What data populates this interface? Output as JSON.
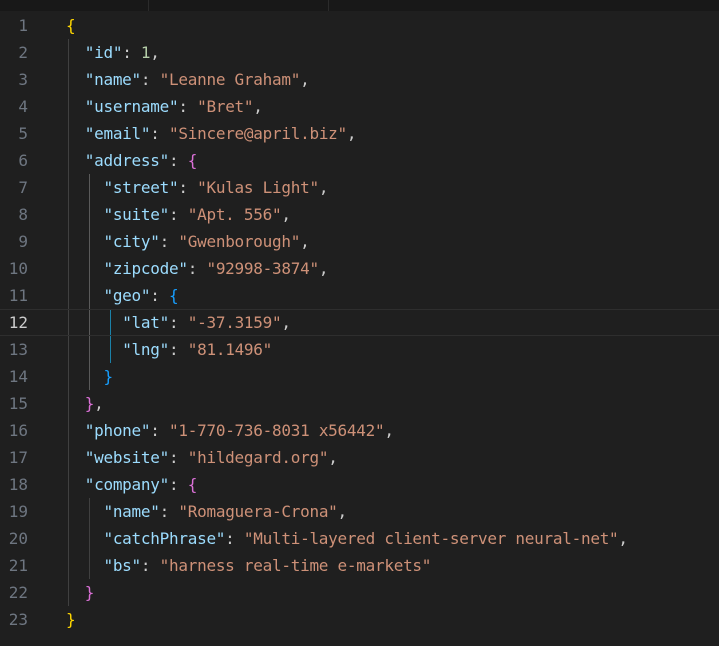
{
  "editor": {
    "active_line": 12,
    "lines": [
      {
        "n": "1",
        "tokens": [
          {
            "t": "{",
            "c": "b1"
          }
        ]
      },
      {
        "n": "2",
        "tokens": [
          {
            "t": "  "
          },
          {
            "t": "\"id\"",
            "c": "key"
          },
          {
            "t": ": "
          },
          {
            "t": "1",
            "c": "num"
          },
          {
            "t": ","
          }
        ]
      },
      {
        "n": "3",
        "tokens": [
          {
            "t": "  "
          },
          {
            "t": "\"name\"",
            "c": "key"
          },
          {
            "t": ": "
          },
          {
            "t": "\"Leanne Graham\"",
            "c": "str"
          },
          {
            "t": ","
          }
        ]
      },
      {
        "n": "4",
        "tokens": [
          {
            "t": "  "
          },
          {
            "t": "\"username\"",
            "c": "key"
          },
          {
            "t": ": "
          },
          {
            "t": "\"Bret\"",
            "c": "str"
          },
          {
            "t": ","
          }
        ]
      },
      {
        "n": "5",
        "tokens": [
          {
            "t": "  "
          },
          {
            "t": "\"email\"",
            "c": "key"
          },
          {
            "t": ": "
          },
          {
            "t": "\"Sincere@april.biz\"",
            "c": "str"
          },
          {
            "t": ","
          }
        ]
      },
      {
        "n": "6",
        "tokens": [
          {
            "t": "  "
          },
          {
            "t": "\"address\"",
            "c": "key"
          },
          {
            "t": ": "
          },
          {
            "t": "{",
            "c": "b2"
          }
        ]
      },
      {
        "n": "7",
        "tokens": [
          {
            "t": "    "
          },
          {
            "t": "\"street\"",
            "c": "key"
          },
          {
            "t": ": "
          },
          {
            "t": "\"Kulas Light\"",
            "c": "str"
          },
          {
            "t": ","
          }
        ]
      },
      {
        "n": "8",
        "tokens": [
          {
            "t": "    "
          },
          {
            "t": "\"suite\"",
            "c": "key"
          },
          {
            "t": ": "
          },
          {
            "t": "\"Apt. 556\"",
            "c": "str"
          },
          {
            "t": ","
          }
        ]
      },
      {
        "n": "9",
        "tokens": [
          {
            "t": "    "
          },
          {
            "t": "\"city\"",
            "c": "key"
          },
          {
            "t": ": "
          },
          {
            "t": "\"Gwenborough\"",
            "c": "str"
          },
          {
            "t": ","
          }
        ]
      },
      {
        "n": "10",
        "tokens": [
          {
            "t": "    "
          },
          {
            "t": "\"zipcode\"",
            "c": "key"
          },
          {
            "t": ": "
          },
          {
            "t": "\"92998-3874\"",
            "c": "str"
          },
          {
            "t": ","
          }
        ]
      },
      {
        "n": "11",
        "tokens": [
          {
            "t": "    "
          },
          {
            "t": "\"geo\"",
            "c": "key"
          },
          {
            "t": ": "
          },
          {
            "t": "{",
            "c": "b3"
          }
        ]
      },
      {
        "n": "12",
        "tokens": [
          {
            "t": "      "
          },
          {
            "t": "\"lat\"",
            "c": "key"
          },
          {
            "t": ": "
          },
          {
            "t": "\"-37.3159\"",
            "c": "str"
          },
          {
            "t": ","
          }
        ]
      },
      {
        "n": "13",
        "tokens": [
          {
            "t": "      "
          },
          {
            "t": "\"lng\"",
            "c": "key"
          },
          {
            "t": ": "
          },
          {
            "t": "\"81.1496\"",
            "c": "str"
          }
        ]
      },
      {
        "n": "14",
        "tokens": [
          {
            "t": "    "
          },
          {
            "t": "}",
            "c": "b3"
          }
        ]
      },
      {
        "n": "15",
        "tokens": [
          {
            "t": "  "
          },
          {
            "t": "}",
            "c": "b2"
          },
          {
            "t": ","
          }
        ]
      },
      {
        "n": "16",
        "tokens": [
          {
            "t": "  "
          },
          {
            "t": "\"phone\"",
            "c": "key"
          },
          {
            "t": ": "
          },
          {
            "t": "\"1-770-736-8031 x56442\"",
            "c": "str"
          },
          {
            "t": ","
          }
        ]
      },
      {
        "n": "17",
        "tokens": [
          {
            "t": "  "
          },
          {
            "t": "\"website\"",
            "c": "key"
          },
          {
            "t": ": "
          },
          {
            "t": "\"hildegard.org\"",
            "c": "str"
          },
          {
            "t": ","
          }
        ]
      },
      {
        "n": "18",
        "tokens": [
          {
            "t": "  "
          },
          {
            "t": "\"company\"",
            "c": "key"
          },
          {
            "t": ": "
          },
          {
            "t": "{",
            "c": "b2"
          }
        ]
      },
      {
        "n": "19",
        "tokens": [
          {
            "t": "    "
          },
          {
            "t": "\"name\"",
            "c": "key"
          },
          {
            "t": ": "
          },
          {
            "t": "\"Romaguera-Crona\"",
            "c": "str"
          },
          {
            "t": ","
          }
        ]
      },
      {
        "n": "20",
        "tokens": [
          {
            "t": "    "
          },
          {
            "t": "\"catchPhrase\"",
            "c": "key"
          },
          {
            "t": ": "
          },
          {
            "t": "\"Multi-layered client-server neural-net\"",
            "c": "str"
          },
          {
            "t": ","
          }
        ]
      },
      {
        "n": "21",
        "tokens": [
          {
            "t": "    "
          },
          {
            "t": "\"bs\"",
            "c": "key"
          },
          {
            "t": ": "
          },
          {
            "t": "\"harness real-time e-markets\"",
            "c": "str"
          }
        ]
      },
      {
        "n": "22",
        "tokens": [
          {
            "t": "  "
          },
          {
            "t": "}",
            "c": "b2"
          }
        ]
      },
      {
        "n": "23",
        "tokens": [
          {
            "t": "}",
            "c": "b1"
          }
        ]
      }
    ]
  },
  "colors": {
    "background": "#1f1f1f",
    "key": "#9cdcfe",
    "string": "#ce9178",
    "number": "#b5cea8",
    "bracket_level_1": "#ffd700",
    "bracket_level_2": "#da70d6",
    "bracket_level_3": "#179fff",
    "line_number": "#6e7681"
  }
}
